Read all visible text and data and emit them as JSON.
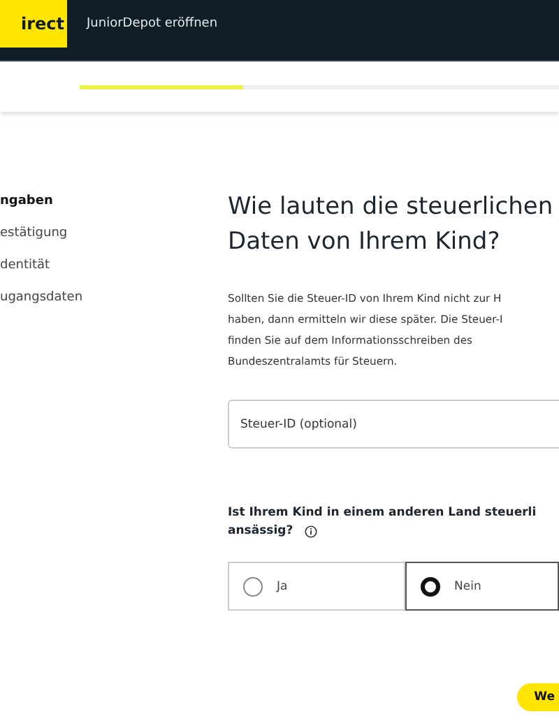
{
  "header": {
    "logo": "irect",
    "nav_link": "JuniorDepot eröffnen"
  },
  "progress": {
    "level": 0.34
  },
  "sidebar": {
    "items": [
      {
        "label": "ngaben",
        "selected": true
      },
      {
        "label": "estätigung",
        "selected": false
      },
      {
        "label": "dentität",
        "selected": false
      },
      {
        "label": "ugangsdaten",
        "selected": false
      }
    ]
  },
  "main": {
    "heading_lines": [
      "Wie lauten die steuerlichen",
      "Daten von Ihrem Kind?"
    ],
    "info_lines": [
      "Sollten Sie die Steuer-ID von Ihrem Kind nicht zur H",
      "haben, dann ermitteln wir diese später. Die Steuer-I",
      "finden Sie auf dem Informationsschreiben des",
      "Bundeszentralamts für Steuern."
    ],
    "tax_id_field": {
      "placeholder": "Steuer-ID (optional)"
    },
    "question_lines": [
      "Ist Ihrem Kind in einem anderen Land steuerli",
      "ansässig?"
    ],
    "options": [
      {
        "label": "Ja",
        "selected": false
      },
      {
        "label": "Nein",
        "selected": true
      }
    ],
    "next_button": "We"
  }
}
